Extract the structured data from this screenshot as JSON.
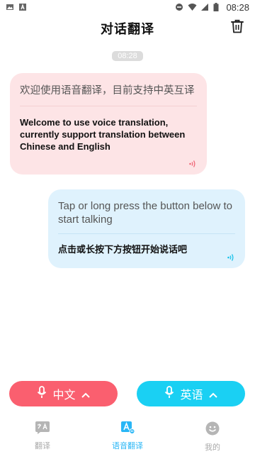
{
  "status_bar": {
    "time": "08:28"
  },
  "header": {
    "title": "对话翻译"
  },
  "conversation": {
    "timestamp": "08:28",
    "messages": [
      {
        "side": "left",
        "source_text": "欢迎使用语音翻译，目前支持中英互译",
        "translation_text": "Welcome to use voice translation, currently support translation between Chinese and English"
      },
      {
        "side": "right",
        "source_text": "Tap or long press the button below to start talking",
        "translation_text": "点击或长按下方按钮开始说话吧"
      }
    ]
  },
  "language_buttons": {
    "left_label": "中文",
    "right_label": "英语"
  },
  "bottom_nav": {
    "items": [
      {
        "label": "翻译"
      },
      {
        "label": "语音翻译"
      },
      {
        "label": "我的"
      }
    ]
  },
  "colors": {
    "left_bubble": "#fde4e6",
    "right_bubble": "#dff2fd",
    "left_button": "#fa5f6f",
    "right_button": "#1ad0f3",
    "active_nav": "#29b6f6"
  }
}
